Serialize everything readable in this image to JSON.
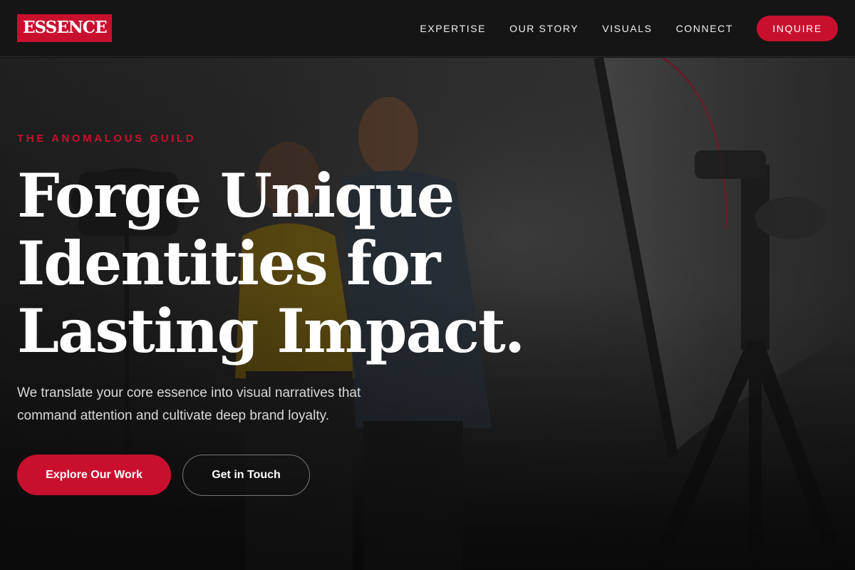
{
  "brand": {
    "logo_text": "ESSENCE",
    "accent": "#c8102e"
  },
  "nav": {
    "items": [
      "EXPERTISE",
      "OUR STORY",
      "VISUALS",
      "CONNECT"
    ],
    "cta": "INQUIRE"
  },
  "hero": {
    "eyebrow": "THE ANOMALOUS GUILD",
    "headline": [
      "Forge Unique",
      "Identities for",
      "Lasting Impact."
    ],
    "subtext": "We translate your core essence into visual narratives that command attention and cultivate deep brand loyalty.",
    "primary_button": "Explore Our Work",
    "secondary_button": "Get in Touch"
  }
}
